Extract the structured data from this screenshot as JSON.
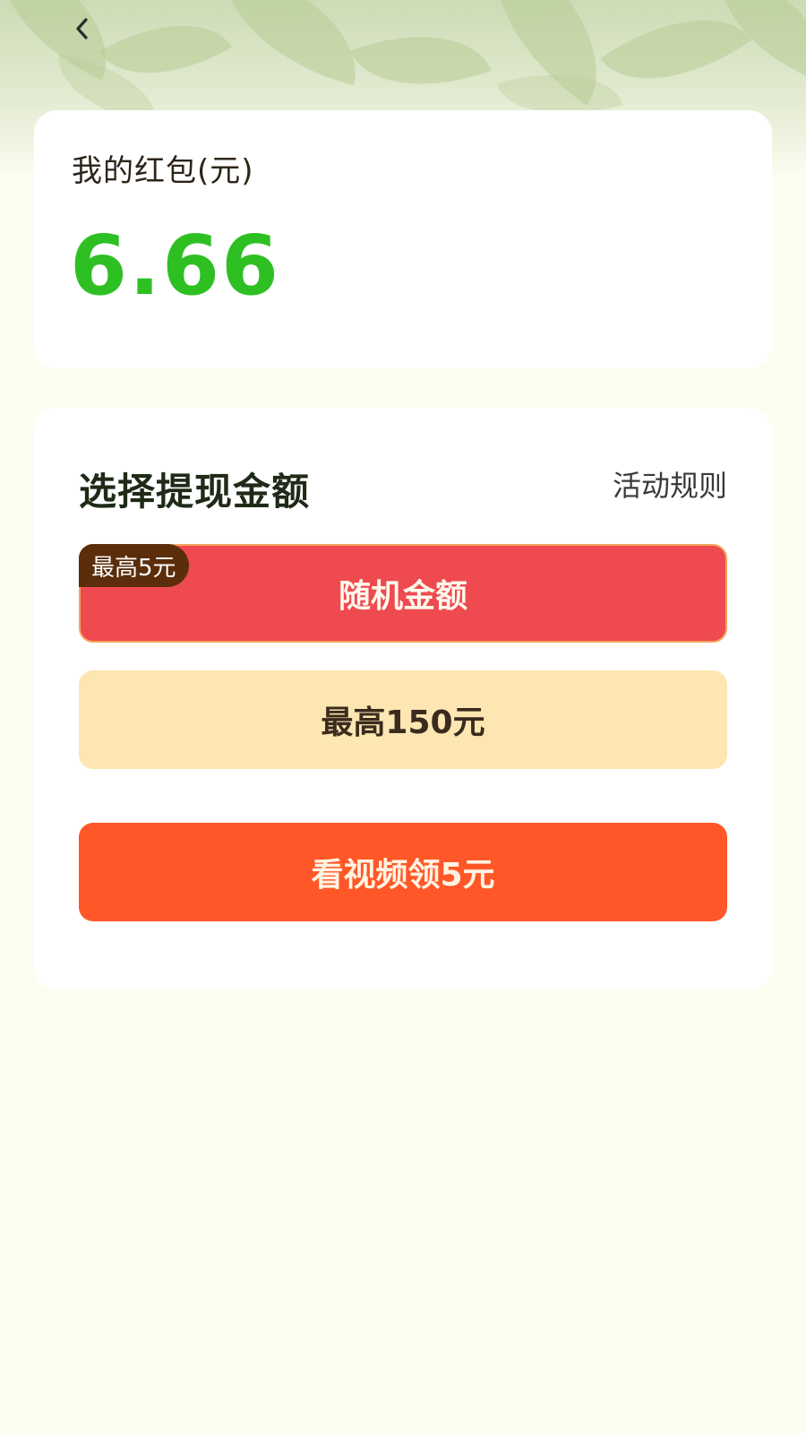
{
  "nav": {
    "back_icon": "chevron-left-icon"
  },
  "balance": {
    "title": "我的红包(元)",
    "value": "6.66"
  },
  "withdraw": {
    "title": "选择提现金额",
    "rules_label": "活动规则",
    "options": [
      {
        "label": "随机金额",
        "badge": "最高5元",
        "selected": true
      },
      {
        "label": "最高150元",
        "selected": false
      }
    ],
    "video_button_label": "看视频领5元"
  },
  "colors": {
    "balance_green": "#2ec023",
    "random_red": "#ee4a4f",
    "max_option_cream": "#fde6b2",
    "video_orange": "#ff5727",
    "badge_brown": "#5b2d0a"
  }
}
